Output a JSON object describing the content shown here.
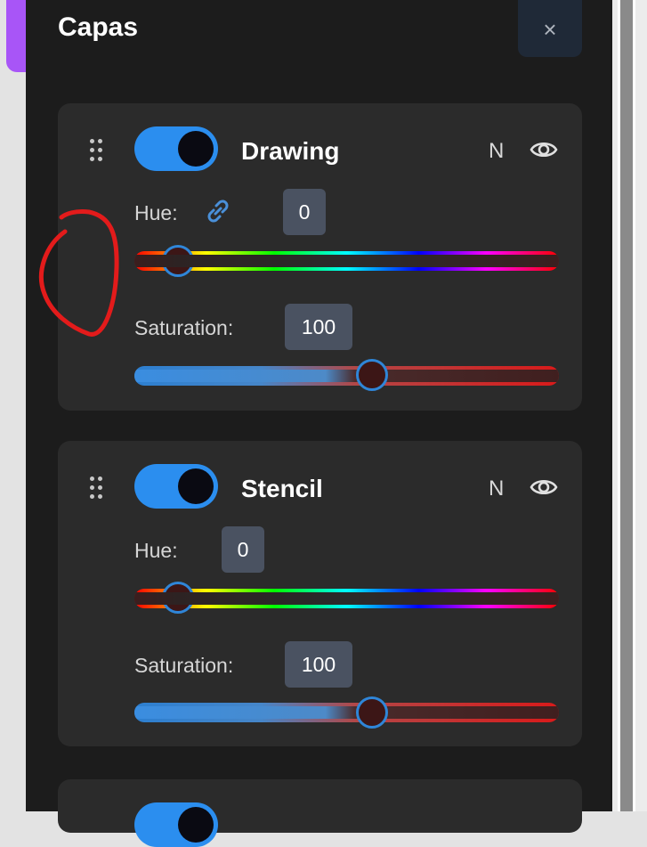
{
  "panel": {
    "title": "Capas",
    "close_label": "×"
  },
  "layers": [
    {
      "name": "Drawing",
      "enabled": true,
      "blend_mode": "N",
      "hue_label": "Hue:",
      "hue_value": "0",
      "hue_linked": true,
      "saturation_label": "Saturation:",
      "saturation_value": "100"
    },
    {
      "name": "Stencil",
      "enabled": true,
      "blend_mode": "N",
      "hue_label": "Hue:",
      "hue_value": "0",
      "hue_linked": false,
      "saturation_label": "Saturation:",
      "saturation_value": "100"
    },
    {
      "enabled": true
    }
  ],
  "colors": {
    "accent": "#2b8eef",
    "panel_bg": "#1c1c1c",
    "card_bg": "#2b2b2b",
    "sidebar_tab": "#a855f7",
    "annotation": "#e31b1b"
  },
  "icons": {
    "drag": "drag-handle-icon",
    "eye": "eye-icon",
    "link": "link-icon",
    "close": "close-icon"
  }
}
